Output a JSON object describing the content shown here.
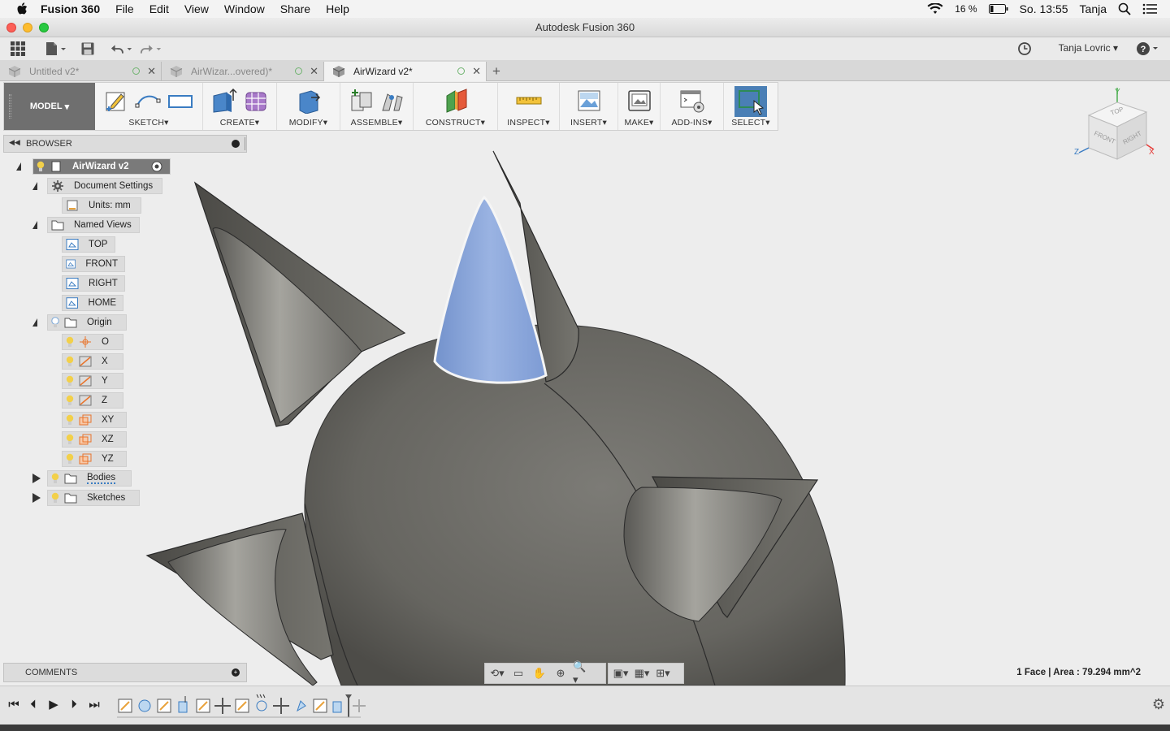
{
  "menubar": {
    "app_name": "Fusion 360",
    "items": [
      "File",
      "Edit",
      "View",
      "Window",
      "Share",
      "Help"
    ],
    "battery": "16 %",
    "clock": "So. 13:55",
    "user": "Tanja"
  },
  "window": {
    "title": "Autodesk Fusion 360"
  },
  "app_toolbar": {
    "user_menu": "Tanja Lovric"
  },
  "tabs": [
    {
      "label": "Untitled v2*",
      "active": false
    },
    {
      "label": "AirWizar...overed)*",
      "active": false
    },
    {
      "label": "AirWizard v2*",
      "active": true
    }
  ],
  "ribbon": {
    "workspace": "MODEL",
    "groups": [
      {
        "label": "SKETCH"
      },
      {
        "label": "CREATE"
      },
      {
        "label": "MODIFY"
      },
      {
        "label": "ASSEMBLE"
      },
      {
        "label": "CONSTRUCT"
      },
      {
        "label": "INSPECT"
      },
      {
        "label": "INSERT"
      },
      {
        "label": "MAKE"
      },
      {
        "label": "ADD-INS"
      },
      {
        "label": "SELECT"
      }
    ]
  },
  "browser": {
    "title": "BROWSER",
    "nodes": {
      "root": "AirWizard v2",
      "doc_settings": "Document Settings",
      "units": "Units: mm",
      "named_views": "Named Views",
      "top": "TOP",
      "front": "FRONT",
      "right": "RIGHT",
      "home": "HOME",
      "origin": "Origin",
      "o": "O",
      "x": "X",
      "y": "Y",
      "z": "Z",
      "xy": "XY",
      "xz": "XZ",
      "yz": "YZ",
      "bodies": "Bodies",
      "sketches": "Sketches"
    }
  },
  "viewcube": {
    "top": "TOP",
    "front": "FRONT",
    "right": "RIGHT",
    "x": "X",
    "y": "Y",
    "z": "Z"
  },
  "comments": {
    "title": "COMMENTS"
  },
  "status": {
    "selection": "1 Face | Area : 79.294 mm^2"
  },
  "colors": {
    "selected_face": "#8aa6d9",
    "body": "#6b6a66",
    "ribbon_select": "#4a7fb5",
    "workspace_button": "#6f6f6f"
  }
}
